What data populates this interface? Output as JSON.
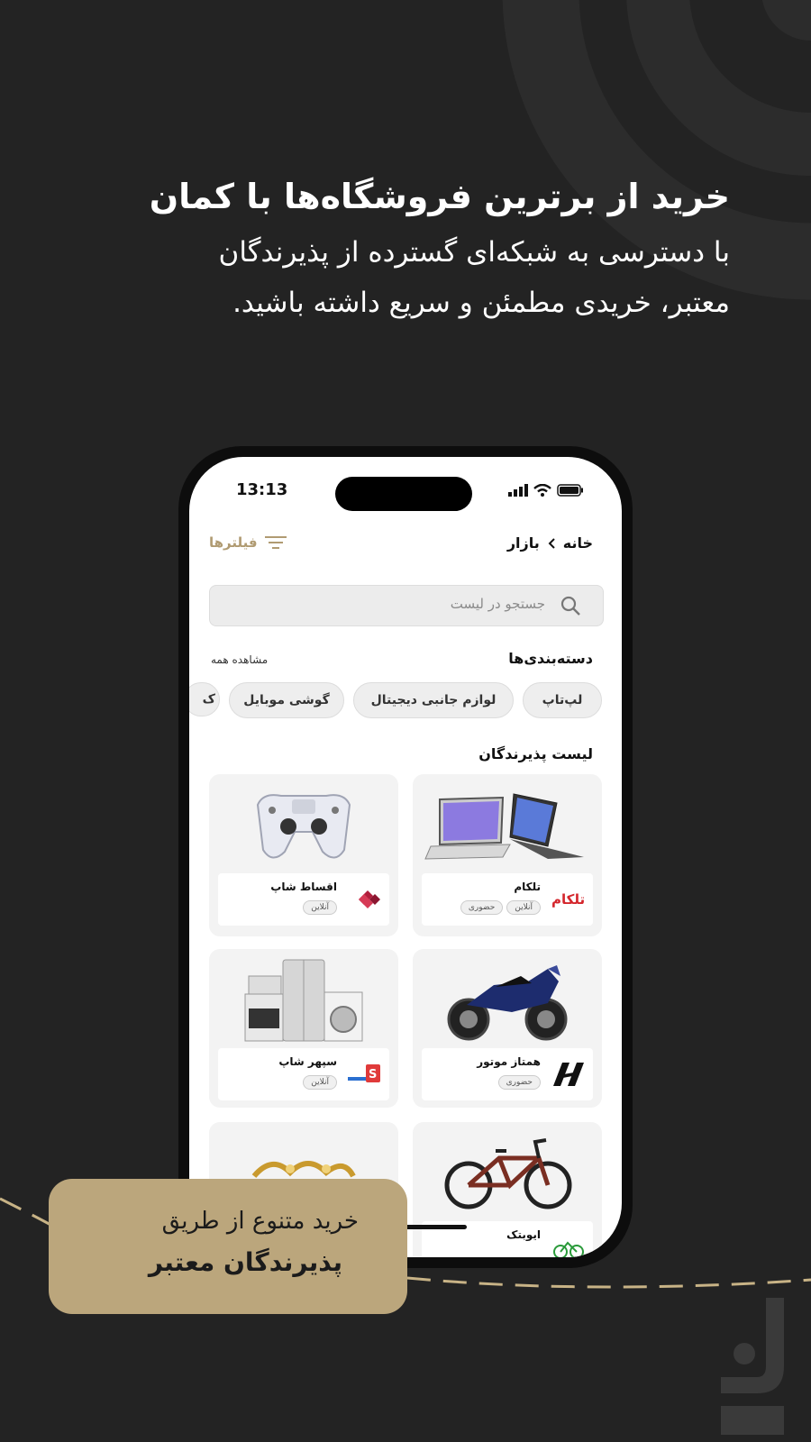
{
  "hero": {
    "title": "خرید از برترین فروشگاه‌ها با کمان",
    "subtitle_line1": "با دسترسی به شبکه‌ای گسترده از پذیرندگان",
    "subtitle_line2": "معتبر، خریدی مطمئن و سریع داشته باشید."
  },
  "status_bar": {
    "time": "13:13"
  },
  "breadcrumb": {
    "home": "خانه",
    "current": "بازار"
  },
  "filters_label": "فیلترها",
  "search": {
    "placeholder": "جستجو در لیست"
  },
  "categories": {
    "title": "دسته‌بندی‌ها",
    "see_all": "مشاهده همه",
    "items": [
      "لپ‌تاپ",
      "لوازم جانبی دیجیتال",
      "گوشی موبایل",
      "ک"
    ]
  },
  "merchants": {
    "title": "لیست پذیرندگان",
    "items": [
      {
        "name": "تلکام",
        "tags": [
          "آنلاین",
          "حضوری"
        ],
        "image": "laptops",
        "logo": "telkam-logo"
      },
      {
        "name": "اقساط شاپ",
        "tags": [
          "آنلاین"
        ],
        "image": "game-controller",
        "logo": "aghsat-logo"
      },
      {
        "name": "همتاز موتور",
        "tags": [
          "حضوری"
        ],
        "image": "motorcycle",
        "logo": "hamtaz-logo"
      },
      {
        "name": "سپهر شاپ",
        "tags": [
          "آنلاین"
        ],
        "image": "home-appliances",
        "logo": "sepehr-logo"
      },
      {
        "name": "ایوبتک",
        "tags": [],
        "image": "bicycle",
        "logo": "ayoubtek-logo"
      }
    ]
  },
  "banner": {
    "line1": "خرید متنوع از طریق",
    "line2": "پذیرندگان معتبر"
  },
  "colors": {
    "background": "#232323",
    "accent_gold": "#bba67c",
    "filter_gold": "#b09b72"
  }
}
